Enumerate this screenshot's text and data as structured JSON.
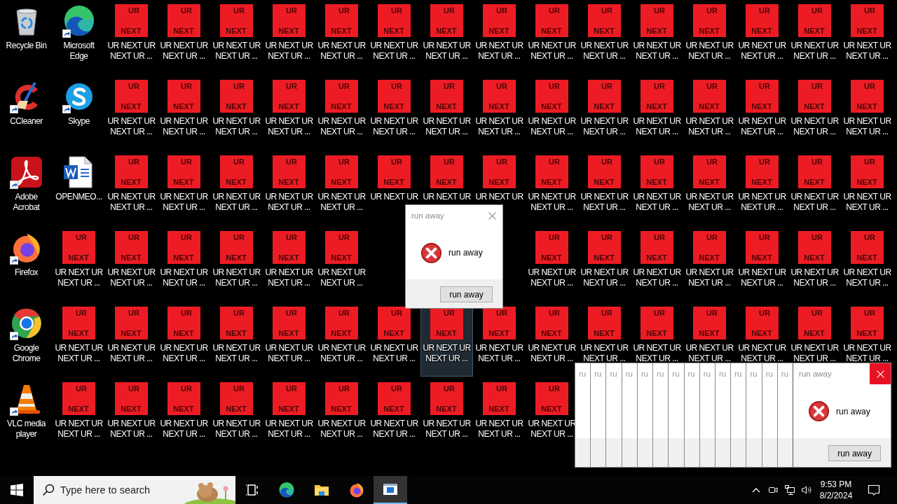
{
  "desktop": {
    "rows": [
      [
        {
          "kind": "app",
          "label": "Recycle Bin",
          "shortcut": false,
          "selected": false
        },
        {
          "kind": "app",
          "label": "Microsoft Edge",
          "shortcut": true,
          "selected": false
        },
        {
          "kind": "ur",
          "top": "UR",
          "bottom": "NEXT",
          "label": "UR NEXT UR NEXT UR ...",
          "selected": false
        },
        {
          "kind": "ur",
          "top": "UR",
          "bottom": "NEXT",
          "label": "UR NEXT UR NEXT UR ...",
          "selected": false
        },
        {
          "kind": "ur",
          "top": "UR",
          "bottom": "NEXT",
          "label": "UR NEXT UR NEXT UR ...",
          "selected": false
        },
        {
          "kind": "ur",
          "top": "UR",
          "bottom": "NEXT",
          "label": "UR NEXT UR NEXT UR ...",
          "selected": false
        },
        {
          "kind": "ur",
          "top": "UR",
          "bottom": "NEXT",
          "label": "UR NEXT UR NEXT UR ...",
          "selected": false
        },
        {
          "kind": "ur",
          "top": "UR",
          "bottom": "NEXT",
          "label": "UR NEXT UR NEXT UR ...",
          "selected": false
        },
        {
          "kind": "ur",
          "top": "UR",
          "bottom": "NEXT",
          "label": "UR NEXT UR NEXT UR ...",
          "selected": false
        },
        {
          "kind": "ur",
          "top": "UR",
          "bottom": "NEXT",
          "label": "UR NEXT UR NEXT UR ...",
          "selected": false
        },
        {
          "kind": "ur",
          "top": "UR",
          "bottom": "NEXT",
          "label": "UR NEXT UR NEXT UR ...",
          "selected": false
        },
        {
          "kind": "ur",
          "top": "UR",
          "bottom": "NEXT",
          "label": "UR NEXT UR NEXT UR ...",
          "selected": false
        },
        {
          "kind": "ur",
          "top": "UR",
          "bottom": "NEXT",
          "label": "UR NEXT UR NEXT UR ...",
          "selected": false
        },
        {
          "kind": "ur",
          "top": "UR",
          "bottom": "NEXT",
          "label": "UR NEXT UR NEXT UR ...",
          "selected": false
        },
        {
          "kind": "ur",
          "top": "UR",
          "bottom": "NEXT",
          "label": "UR NEXT UR NEXT UR ...",
          "selected": false
        },
        {
          "kind": "ur",
          "top": "UR",
          "bottom": "NEXT",
          "label": "UR NEXT UR NEXT UR ...",
          "selected": false
        },
        {
          "kind": "ur",
          "top": "UR",
          "bottom": "NEXT",
          "label": "UR NEXT UR NEXT UR ...",
          "selected": false
        }
      ],
      [
        {
          "kind": "app",
          "label": "CCleaner",
          "shortcut": true,
          "selected": false
        },
        {
          "kind": "app",
          "label": "Skype",
          "shortcut": true,
          "selected": false
        },
        {
          "kind": "ur",
          "top": "UR",
          "bottom": "NEXT",
          "label": "UR NEXT UR NEXT UR ...",
          "selected": false
        },
        {
          "kind": "ur",
          "top": "UR",
          "bottom": "NEXT",
          "label": "UR NEXT UR NEXT UR ...",
          "selected": false
        },
        {
          "kind": "ur",
          "top": "UR",
          "bottom": "NEXT",
          "label": "UR NEXT UR NEXT UR ...",
          "selected": false
        },
        {
          "kind": "ur",
          "top": "UR",
          "bottom": "NEXT",
          "label": "UR NEXT UR NEXT UR ...",
          "selected": false
        },
        {
          "kind": "ur",
          "top": "UR",
          "bottom": "NEXT",
          "label": "UR NEXT UR NEXT UR ...",
          "selected": false
        },
        {
          "kind": "ur",
          "top": "UR",
          "bottom": "NEXT",
          "label": "UR NEXT UR NEXT UR ...",
          "selected": false
        },
        {
          "kind": "ur",
          "top": "UR",
          "bottom": "NEXT",
          "label": "UR NEXT UR NEXT UR ...",
          "selected": false
        },
        {
          "kind": "ur",
          "top": "UR",
          "bottom": "NEXT",
          "label": "UR NEXT UR NEXT UR ...",
          "selected": false
        },
        {
          "kind": "ur",
          "top": "UR",
          "bottom": "NEXT",
          "label": "UR NEXT UR NEXT UR ...",
          "selected": false
        },
        {
          "kind": "ur",
          "top": "UR",
          "bottom": "NEXT",
          "label": "UR NEXT UR NEXT UR ...",
          "selected": false
        },
        {
          "kind": "ur",
          "top": "UR",
          "bottom": "NEXT",
          "label": "UR NEXT UR NEXT UR ...",
          "selected": false
        },
        {
          "kind": "ur",
          "top": "UR",
          "bottom": "NEXT",
          "label": "UR NEXT UR NEXT UR ...",
          "selected": false
        },
        {
          "kind": "ur",
          "top": "UR",
          "bottom": "NEXT",
          "label": "UR NEXT UR NEXT UR ...",
          "selected": false
        },
        {
          "kind": "ur",
          "top": "UR",
          "bottom": "NEXT",
          "label": "UR NEXT UR NEXT UR ...",
          "selected": false
        },
        {
          "kind": "ur",
          "top": "UR",
          "bottom": "NEXT",
          "label": "UR NEXT UR NEXT UR ...",
          "selected": false
        }
      ],
      [
        {
          "kind": "app",
          "label": "Adobe Acrobat",
          "shortcut": true,
          "selected": false
        },
        {
          "kind": "document",
          "label": "OPENMEO...",
          "shortcut": false,
          "selected": false
        },
        {
          "kind": "ur",
          "top": "UR",
          "bottom": "NEXT",
          "label": "UR NEXT UR NEXT UR ...",
          "selected": false
        },
        {
          "kind": "ur",
          "top": "UR",
          "bottom": "NEXT",
          "label": "UR NEXT UR NEXT UR ...",
          "selected": false
        },
        {
          "kind": "ur",
          "top": "UR",
          "bottom": "NEXT",
          "label": "UR NEXT UR NEXT UR ...",
          "selected": false
        },
        {
          "kind": "ur",
          "top": "UR",
          "bottom": "NEXT",
          "label": "UR NEXT UR NEXT UR ...",
          "selected": false
        },
        {
          "kind": "ur",
          "top": "UR",
          "bottom": "NEXT",
          "label": "UR NEXT UR NEXT UR ...",
          "selected": false
        },
        {
          "kind": "ur",
          "top": "UR",
          "bottom": "NEXT",
          "label": "UR NEXT UR",
          "selected": false
        },
        {
          "kind": "ur",
          "top": "UR",
          "bottom": "NEXT",
          "label": "UR NEXT UR",
          "selected": false
        },
        {
          "kind": "ur",
          "top": "UR",
          "bottom": "NEXT",
          "label": "UR NEXT UR",
          "selected": false
        },
        {
          "kind": "ur",
          "top": "UR",
          "bottom": "NEXT",
          "label": "UR NEXT UR NEXT UR ...",
          "selected": false
        },
        {
          "kind": "ur",
          "top": "UR",
          "bottom": "NEXT",
          "label": "UR NEXT UR NEXT UR ...",
          "selected": false
        },
        {
          "kind": "ur",
          "top": "UR",
          "bottom": "NEXT",
          "label": "UR NEXT UR NEXT UR ...",
          "selected": false
        },
        {
          "kind": "ur",
          "top": "UR",
          "bottom": "NEXT",
          "label": "UR NEXT UR NEXT UR ...",
          "selected": false
        },
        {
          "kind": "ur",
          "top": "UR",
          "bottom": "NEXT",
          "label": "UR NEXT UR NEXT UR ...",
          "selected": false
        },
        {
          "kind": "ur",
          "top": "UR",
          "bottom": "NEXT",
          "label": "UR NEXT UR NEXT UR ...",
          "selected": false
        },
        {
          "kind": "ur",
          "top": "UR",
          "bottom": "NEXT",
          "label": "UR NEXT UR NEXT UR ...",
          "selected": false
        }
      ],
      [
        {
          "kind": "app",
          "label": "Firefox",
          "shortcut": true,
          "selected": false
        },
        {
          "kind": "ur",
          "top": "UR",
          "bottom": "NEXT",
          "label": "UR NEXT UR NEXT UR ...",
          "selected": false
        },
        {
          "kind": "ur",
          "top": "UR",
          "bottom": "NEXT",
          "label": "UR NEXT UR NEXT UR ...",
          "selected": false
        },
        {
          "kind": "ur",
          "top": "UR",
          "bottom": "NEXT",
          "label": "UR NEXT UR NEXT UR ...",
          "selected": false
        },
        {
          "kind": "ur",
          "top": "UR",
          "bottom": "NEXT",
          "label": "UR NEXT UR NEXT UR ...",
          "selected": false
        },
        {
          "kind": "ur",
          "top": "UR",
          "bottom": "NEXT",
          "label": "UR NEXT UR NEXT UR ...",
          "selected": false
        },
        {
          "kind": "ur",
          "top": "UR",
          "bottom": "NEXT",
          "label": "UR NEXT UR NEXT UR ...",
          "selected": false
        },
        null,
        null,
        null,
        {
          "kind": "ur",
          "top": "UR",
          "bottom": "NEXT",
          "label": "UR NEXT UR NEXT UR ...",
          "selected": false
        },
        {
          "kind": "ur",
          "top": "UR",
          "bottom": "NEXT",
          "label": "UR NEXT UR NEXT UR ...",
          "selected": false
        },
        {
          "kind": "ur",
          "top": "UR",
          "bottom": "NEXT",
          "label": "UR NEXT UR NEXT UR ...",
          "selected": false
        },
        {
          "kind": "ur",
          "top": "UR",
          "bottom": "NEXT",
          "label": "UR NEXT UR NEXT UR ...",
          "selected": false
        },
        {
          "kind": "ur",
          "top": "UR",
          "bottom": "NEXT",
          "label": "UR NEXT UR NEXT UR ...",
          "selected": false
        },
        {
          "kind": "ur",
          "top": "UR",
          "bottom": "NEXT",
          "label": "UR NEXT UR NEXT UR ...",
          "selected": false
        },
        {
          "kind": "ur",
          "top": "UR",
          "bottom": "NEXT",
          "label": "UR NEXT UR NEXT UR ...",
          "selected": false
        }
      ],
      [
        {
          "kind": "app",
          "label": "Google Chrome",
          "shortcut": true,
          "selected": false
        },
        {
          "kind": "ur",
          "top": "UR",
          "bottom": "NEXT",
          "label": "UR NEXT UR NEXT UR ...",
          "selected": false
        },
        {
          "kind": "ur",
          "top": "UR",
          "bottom": "NEXT",
          "label": "UR NEXT UR NEXT UR ...",
          "selected": false
        },
        {
          "kind": "ur",
          "top": "UR",
          "bottom": "NEXT",
          "label": "UR NEXT UR NEXT UR ...",
          "selected": false
        },
        {
          "kind": "ur",
          "top": "UR",
          "bottom": "NEXT",
          "label": "UR NEXT UR NEXT UR ...",
          "selected": false
        },
        {
          "kind": "ur",
          "top": "UR",
          "bottom": "NEXT",
          "label": "UR NEXT UR NEXT UR ...",
          "selected": false
        },
        {
          "kind": "ur",
          "top": "UR",
          "bottom": "NEXT",
          "label": "UR NEXT UR NEXT UR ...",
          "selected": false
        },
        {
          "kind": "ur",
          "top": "UR",
          "bottom": "NEXT",
          "label": "UR NEXT UR NEXT UR ...",
          "selected": false
        },
        {
          "kind": "ur",
          "top": "UR",
          "bottom": "NEXT",
          "label": "UR NEXT UR NEXT UR ...",
          "selected": true
        },
        {
          "kind": "ur",
          "top": "UR",
          "bottom": "NEXT",
          "label": "UR NEXT UR NEXT UR ...",
          "selected": false
        },
        {
          "kind": "ur",
          "top": "UR",
          "bottom": "NEXT",
          "label": "UR NEXT UR NEXT UR ...",
          "selected": false
        },
        {
          "kind": "ur",
          "top": "UR",
          "bottom": "NEXT",
          "label": "UR NEXT UR NEXT UR ...",
          "selected": false
        },
        {
          "kind": "ur",
          "top": "UR",
          "bottom": "NEXT",
          "label": "UR NEXT UR NEXT UR ...",
          "selected": false
        },
        {
          "kind": "ur",
          "top": "UR",
          "bottom": "NEXT",
          "label": "UR NEXT UR NEXT UR ...",
          "selected": false
        },
        {
          "kind": "ur",
          "top": "UR",
          "bottom": "NEXT",
          "label": "UR NEXT UR NEXT UR ...",
          "selected": false
        },
        {
          "kind": "ur",
          "top": "UR",
          "bottom": "NEXT",
          "label": "UR NEXT UR NEXT UR ...",
          "selected": false
        },
        {
          "kind": "ur",
          "top": "UR",
          "bottom": "NEXT",
          "label": "UR NEXT UR NEXT UR ...",
          "selected": false
        }
      ],
      [
        {
          "kind": "app",
          "label": "VLC media player",
          "shortcut": true,
          "selected": false
        },
        {
          "kind": "ur",
          "top": "UR",
          "bottom": "NEXT",
          "label": "UR NEXT UR NEXT UR ...",
          "selected": false
        },
        {
          "kind": "ur",
          "top": "UR",
          "bottom": "NEXT",
          "label": "UR NEXT UR NEXT UR ...",
          "selected": false
        },
        {
          "kind": "ur",
          "top": "UR",
          "bottom": "NEXT",
          "label": "UR NEXT UR NEXT UR ...",
          "selected": false
        },
        {
          "kind": "ur",
          "top": "UR",
          "bottom": "NEXT",
          "label": "UR NEXT UR NEXT UR ...",
          "selected": false
        },
        {
          "kind": "ur",
          "top": "UR",
          "bottom": "NEXT",
          "label": "UR NEXT UR NEXT UR ...",
          "selected": false
        },
        {
          "kind": "ur",
          "top": "UR",
          "bottom": "NEXT",
          "label": "UR NEXT UR NEXT UR ...",
          "selected": false
        },
        {
          "kind": "ur",
          "top": "UR",
          "bottom": "NEXT",
          "label": "UR NEXT UR NEXT UR ...",
          "selected": false
        },
        {
          "kind": "ur",
          "top": "UR",
          "bottom": "NEXT",
          "label": "UR NEXT UR NEXT UR ...",
          "selected": false
        },
        {
          "kind": "ur",
          "top": "UR",
          "bottom": "NEXT",
          "label": "UR NEXT UR NEXT UR ...",
          "selected": false
        },
        {
          "kind": "ur",
          "top": "UR",
          "bottom": "NEXT",
          "label": "UR NEXT UR NEXT UR ...",
          "selected": false
        }
      ]
    ]
  },
  "dialog": {
    "title": "run away",
    "message": "run away",
    "button": "run away",
    "close_hovered": false
  },
  "dialog_stack": {
    "slivers": [
      {
        "title": "ru"
      },
      {
        "title": "ru"
      },
      {
        "title": "ru"
      },
      {
        "title": "ru"
      },
      {
        "title": "ru"
      },
      {
        "title": "ru"
      },
      {
        "title": "ru"
      },
      {
        "title": "ru"
      },
      {
        "title": "ru"
      },
      {
        "title": "ru"
      },
      {
        "title": "ru"
      },
      {
        "title": "ru"
      },
      {
        "title": "ru"
      },
      {
        "title": "ru"
      }
    ],
    "front": {
      "title": "run away",
      "message": "run away",
      "button": "run away",
      "close_hovered": true
    }
  },
  "taskbar": {
    "search": {
      "placeholder": "Type here to search"
    },
    "pinned": [
      {
        "active": false
      },
      {
        "active": false
      },
      {
        "active": false
      },
      {
        "active": false
      },
      {
        "active": true
      }
    ],
    "clock": {
      "time": "9:53 PM",
      "date": "8/2/2024"
    }
  }
}
